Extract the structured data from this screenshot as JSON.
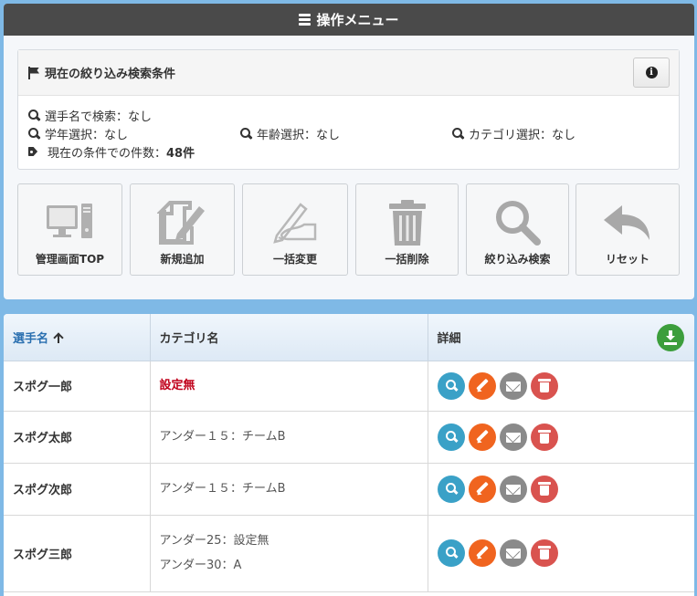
{
  "panel": {
    "title": "操作メニュー"
  },
  "conditions": {
    "title": "現在の絞り込み検索条件",
    "name_search": "選手名で検索：なし",
    "grade": "学年選択：なし",
    "age": "年齢選択：なし",
    "category": "カテゴリ選択：なし",
    "count_label": "現在の条件での件数：",
    "count_value": "48件"
  },
  "tiles": [
    {
      "label": "管理画面TOP",
      "icon": "computer-icon"
    },
    {
      "label": "新規追加",
      "icon": "edit-note-icon"
    },
    {
      "label": "一括変更",
      "icon": "pen-hand-icon"
    },
    {
      "label": "一括削除",
      "icon": "trash-icon"
    },
    {
      "label": "絞り込み検索",
      "icon": "search-icon"
    },
    {
      "label": "リセット",
      "icon": "reply-icon"
    }
  ],
  "table": {
    "headers": {
      "name": "選手名",
      "category": "カテゴリ名",
      "detail": "詳細"
    },
    "rows": [
      {
        "name": "スポグ一郎",
        "categories": [
          "設定無"
        ],
        "unset": true
      },
      {
        "name": "スポグ太郎",
        "categories": [
          "アンダー１５：チームB"
        ],
        "unset": false
      },
      {
        "name": "スポグ次郎",
        "categories": [
          "アンダー１５：チームB"
        ],
        "unset": false
      },
      {
        "name": "スポグ三郎",
        "categories": [
          "アンダー25：設定無",
          "アンダー30：A"
        ],
        "unset": false
      }
    ]
  },
  "colors": {
    "accent": "#7fb9e6",
    "view": "#3aa1c7",
    "edit": "#f0641f",
    "mail": "#8a8a8a",
    "delete": "#d9534f",
    "download": "#3c9e3c",
    "unset": "#c0001a"
  }
}
